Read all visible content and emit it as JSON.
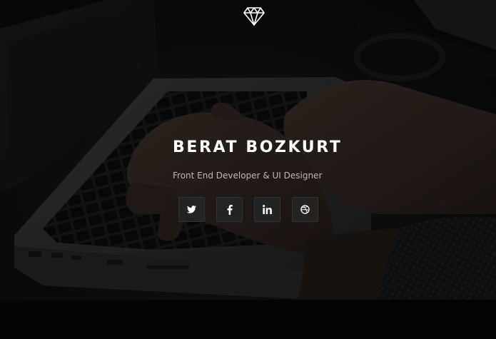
{
  "hero": {
    "name": "BERAT BOZKURT",
    "tagline": "Front End Developer & UI Designer"
  },
  "logo": {
    "icon": "diamond-icon"
  },
  "socials": [
    {
      "icon": "twitter-icon"
    },
    {
      "icon": "facebook-icon"
    },
    {
      "icon": "linkedin-icon"
    },
    {
      "icon": "dribbble-icon"
    }
  ],
  "colors": {
    "text": "#ffffff",
    "tagline": "#b9b9b9",
    "button_bg": "#262626",
    "button_border": "#323232",
    "background": "#0b0b0c"
  }
}
